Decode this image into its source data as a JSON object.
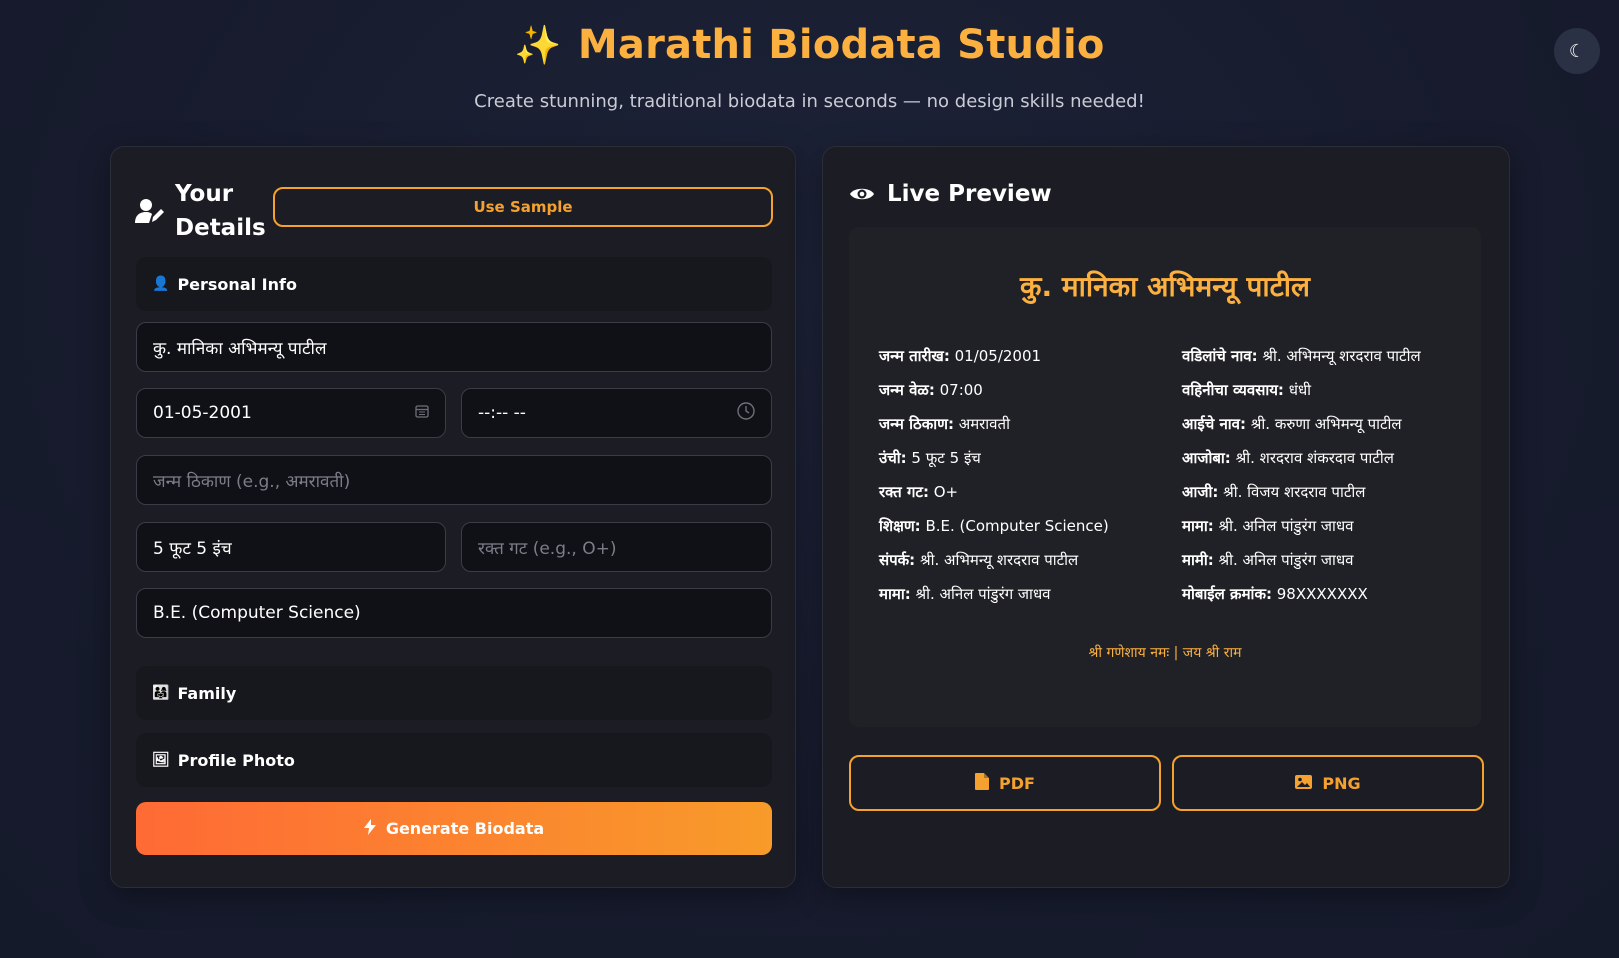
{
  "header": {
    "title": "Marathi Biodata Studio",
    "subtitle": "Create stunning, traditional biodata in seconds — no design skills needed!",
    "theme_toggle_icon": "moon-icon"
  },
  "form": {
    "title": "Your Details",
    "sample_button": "Use Sample",
    "sections": {
      "personal": "Personal Info",
      "family": "Family",
      "photo": "Profile Photo"
    },
    "fields": {
      "full_name": {
        "value": "कु. मानिका अभिमन्यू पाटील"
      },
      "birth_date": {
        "value": "01-05-2001"
      },
      "birth_time": {
        "value": "--:-- --"
      },
      "birth_place": {
        "placeholder": "जन्म ठिकाण (e.g., अमरावती)"
      },
      "height": {
        "value": "5 फूट 5 इंच"
      },
      "blood_group": {
        "placeholder": "रक्त गट (e.g., O+)"
      },
      "education": {
        "value": "B.E. (Computer Science)"
      }
    },
    "generate_button": "Generate Biodata"
  },
  "preview": {
    "title": "Live Preview",
    "name": "कु. मानिका अभिमन्यू पाटील",
    "left_column": [
      {
        "label": "जन्म तारीख:",
        "value": "01/05/2001"
      },
      {
        "label": "जन्म वेळ:",
        "value": "07:00"
      },
      {
        "label": "जन्म ठिकाण:",
        "value": "अमरावती"
      },
      {
        "label": "उंची:",
        "value": "5 फूट 5 इंच"
      },
      {
        "label": "रक्त गट:",
        "value": "O+"
      },
      {
        "label": "शिक्षण:",
        "value": "B.E. (Computer Science)"
      },
      {
        "label": "संपर्क:",
        "value": "श्री. अभिमन्यू शरदराव पाटील"
      },
      {
        "label": "मामा:",
        "value": "श्री. अनिल पांडुरंग जाधव"
      }
    ],
    "right_column": [
      {
        "label": "वडिलांचे नाव:",
        "value": "श्री. अभिमन्यू शरदराव पाटील"
      },
      {
        "label": "वहिनीचा व्यवसाय:",
        "value": "धंधी"
      },
      {
        "label": "आईचे नाव:",
        "value": "श्री. करुणा अभिमन्यू पाटील"
      },
      {
        "label": "आजोबा:",
        "value": "श्री. शरदराव शंकरदाव पाटील"
      },
      {
        "label": "आजी:",
        "value": "श्री. विजय शरदराव पाटील"
      },
      {
        "label": "मामा:",
        "value": "श्री. अनिल पांडुरंग जाधव"
      },
      {
        "label": "मामी:",
        "value": "श्री. अनिल पांडुरंग जाधव"
      },
      {
        "label": "मोबाईल क्रमांक:",
        "value": "98XXXXXXX"
      }
    ],
    "footer": "श्री गणेशाय नमः | जय श्री राम",
    "buttons": {
      "pdf": "PDF",
      "png": "PNG"
    }
  },
  "colors": {
    "accent": "#fbb040",
    "background": "#181d31",
    "card": "#1c1d24",
    "gradient_start": "#ff6a35",
    "gradient_end": "#f89b2a"
  }
}
